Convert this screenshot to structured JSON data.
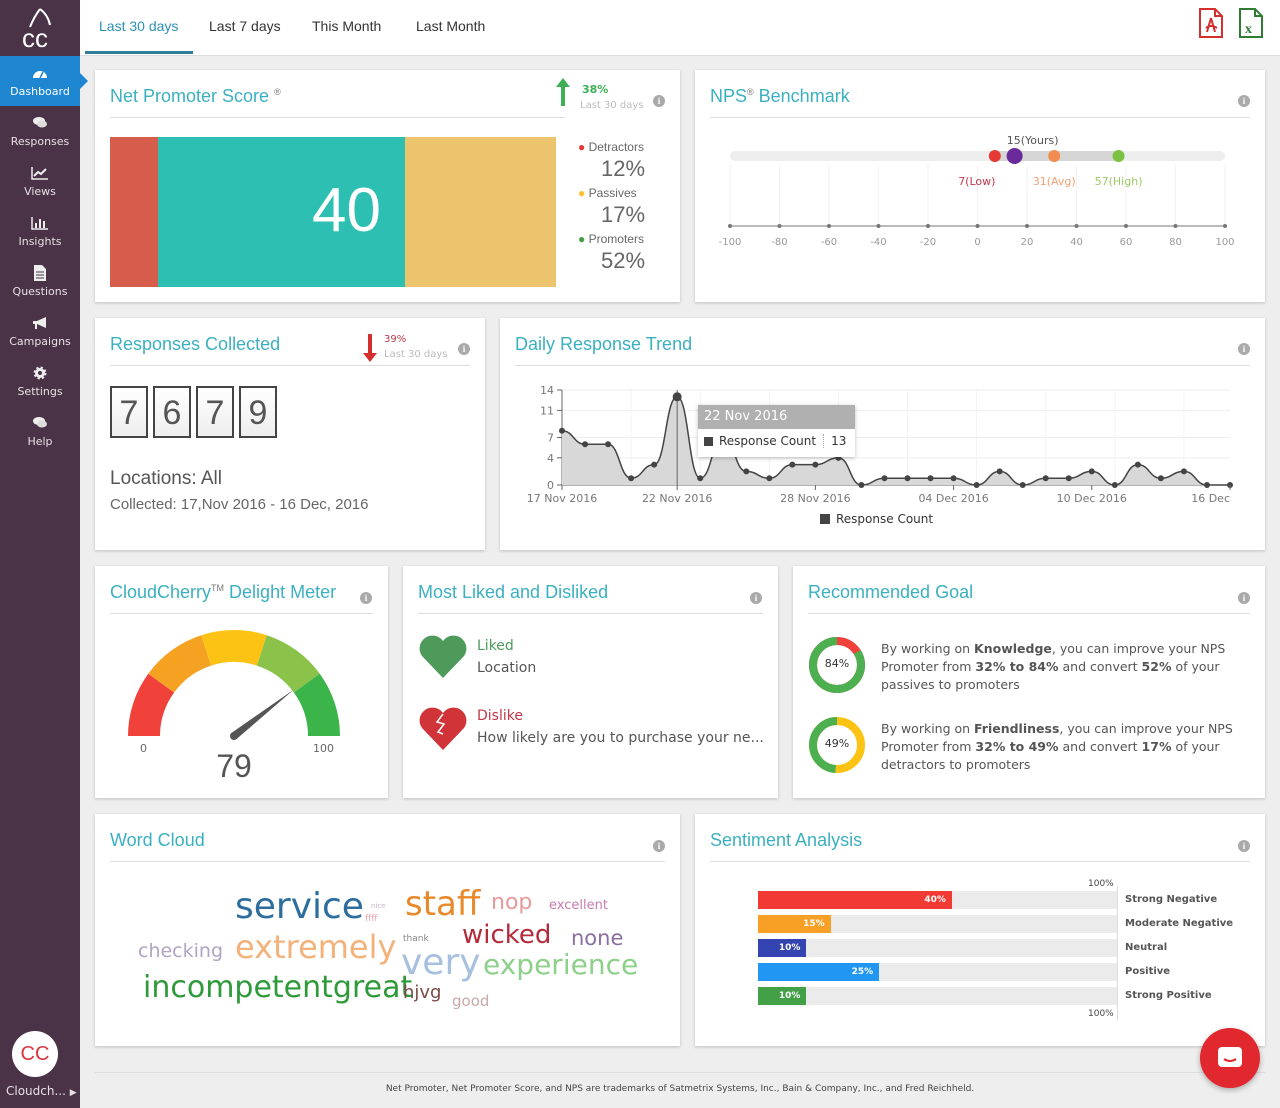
{
  "app": {
    "user_name": "Cloudch...",
    "user_initials": "CC"
  },
  "sidebar": {
    "items": [
      {
        "label": "Dashboard",
        "icon": "dashboard-icon",
        "active": true
      },
      {
        "label": "Responses",
        "icon": "comments-icon"
      },
      {
        "label": "Views",
        "icon": "line-chart-icon"
      },
      {
        "label": "Insights",
        "icon": "bar-chart-icon"
      },
      {
        "label": "Questions",
        "icon": "document-icon"
      },
      {
        "label": "Campaigns",
        "icon": "megaphone-icon"
      },
      {
        "label": "Settings",
        "icon": "gear-icon"
      },
      {
        "label": "Help",
        "icon": "chat-icon"
      }
    ]
  },
  "topbar": {
    "tabs": [
      {
        "label": "Last 30 days",
        "active": true
      },
      {
        "label": "Last 7 days"
      },
      {
        "label": "This Month"
      },
      {
        "label": "Last Month"
      }
    ],
    "export_pdf": "pdf-export-icon",
    "export_excel": "excel-export-icon"
  },
  "nps": {
    "title": "Net Promoter Score",
    "trademark": "®",
    "score": "40",
    "change": "38%",
    "change_period": "Last 30 days",
    "change_direction": "up",
    "detractors_label": "Detractors",
    "detractors_value": "12%",
    "passives_label": "Passives",
    "passives_value": "17%",
    "promoters_label": "Promoters",
    "promoters_value": "52%",
    "colors": {
      "detractors": "#d65c4c",
      "promoters": "#2cbfb2",
      "passives": "#ecc46e"
    }
  },
  "benchmark": {
    "title": "NPS",
    "title_suffix": " Benchmark",
    "trademark": "®",
    "yours_label": "15(Yours)",
    "yours": 15,
    "low_label": "7(Low)",
    "low": 7,
    "avg_label": "31(Avg)",
    "avg": 31,
    "high_label": "57(High)",
    "high": 57,
    "axis_ticks": [
      "-100",
      "-80",
      "-60",
      "-40",
      "-20",
      "0",
      "20",
      "40",
      "60",
      "80",
      "100"
    ]
  },
  "responses": {
    "title": "Responses Collected",
    "change": "39%",
    "change_period": "Last 30 days",
    "change_direction": "down",
    "digits": [
      "7",
      "6",
      "7",
      "9"
    ],
    "locations": "Locations: All",
    "collected": "Collected:  17,Nov 2016 - 16 Dec, 2016"
  },
  "trend": {
    "title": "Daily Response Trend",
    "tooltip_date": "22 Nov 2016",
    "tooltip_series": "Response Count",
    "tooltip_value": "13",
    "legend": "Response Count"
  },
  "chart_data": {
    "type": "area",
    "title": "Daily Response Trend",
    "xlabel": "",
    "ylabel": "",
    "ylim": [
      0,
      14
    ],
    "y_ticks": [
      "0",
      "4",
      "7",
      "11",
      "14"
    ],
    "x_tick_labels": [
      "17 Nov 2016",
      "22 Nov 2016",
      "28 Nov 2016",
      "04 Dec 2016",
      "10 Dec 2016",
      "16 Dec"
    ],
    "x_tick_days": [
      0,
      5,
      11,
      17,
      23,
      29
    ],
    "grid": true,
    "legend": "bottom",
    "series": [
      {
        "name": "Response Count",
        "values": [
          8,
          6,
          6,
          1,
          3,
          13,
          1,
          7,
          2,
          1,
          3,
          3,
          4,
          0,
          1,
          1,
          1,
          1,
          0,
          2,
          0,
          1,
          1,
          2,
          0,
          3,
          1,
          2,
          0,
          0
        ]
      }
    ]
  },
  "delight": {
    "title": "CloudCherry",
    "trademark": "TM",
    "title_suffix": " Delight Meter",
    "value": 79,
    "value_label": "79",
    "min_label": "0",
    "max_label": "100",
    "band_colors": [
      "#f0413a",
      "#f5a223",
      "#fdc314",
      "#8bc34a",
      "#3bb44a"
    ]
  },
  "liked": {
    "title": "Most Liked and Disliked",
    "liked_label": "Liked",
    "liked_value": "Location",
    "dislike_label": "Dislike",
    "dislike_value": "How likely are you to purchase your ne..."
  },
  "goal": {
    "title": "Recommended Goal",
    "items": [
      {
        "percent": 84,
        "percent_label": "84%",
        "p1": "By working on ",
        "b1": "Knowledge",
        "p2": ", you can improve your NPS Promoter from ",
        "b2": "32% to 84%",
        "p3": " and convert ",
        "b3": "52%",
        "p4": " of your passives to promoters",
        "ring_color": "#4caf50",
        "rest_color": "#f0413a"
      },
      {
        "percent": 49,
        "percent_label": "49%",
        "p1": "By working on ",
        "b1": "Friendliness",
        "p2": ", you can improve your NPS Promoter from ",
        "b2": "32% to 49%",
        "p3": " and convert ",
        "b3": "17%",
        "p4": " of your detractors to promoters",
        "ring_color": "#4caf50",
        "rest_color": "#fdc314"
      }
    ]
  },
  "wordcloud": {
    "title": "Word Cloud",
    "words": [
      {
        "text": "service",
        "color": "#2d6e9e"
      },
      {
        "text": "nice",
        "color": "#c9b7c9"
      },
      {
        "text": "ffff",
        "color": "#e6a6b4"
      },
      {
        "text": "staff",
        "color": "#e88a2c"
      },
      {
        "text": "nop",
        "color": "#e69a9c"
      },
      {
        "text": "excellent",
        "color": "#c77ab0"
      },
      {
        "text": "checking",
        "color": "#b0a4c4"
      },
      {
        "text": "extremely",
        "color": "#f2b27a"
      },
      {
        "text": "thank",
        "color": "#888"
      },
      {
        "text": "wicked",
        "color": "#b32a3a"
      },
      {
        "text": "none",
        "color": "#8a6fa0"
      },
      {
        "text": "very",
        "color": "#a7c0e0"
      },
      {
        "text": "experience",
        "color": "#8cd08a"
      },
      {
        "text": "incompetentgreat",
        "color": "#2e9a3a"
      },
      {
        "text": "hjvg",
        "color": "#7a4b44"
      },
      {
        "text": "good",
        "color": "#c9a8a8"
      }
    ]
  },
  "sentiment": {
    "title": "Sentiment Analysis",
    "top_label": "100%",
    "bottom_label": "100%",
    "bars": [
      {
        "label": "Strong Negative",
        "value": 40,
        "value_label": "40%",
        "color": "#f23a34"
      },
      {
        "label": "Moderate Negative",
        "value": 15,
        "value_label": "15%",
        "color": "#f7a025"
      },
      {
        "label": "Neutral",
        "value": 10,
        "value_label": "10%",
        "color": "#3344b0"
      },
      {
        "label": "Positive",
        "value": 25,
        "value_label": "25%",
        "color": "#2196f3"
      },
      {
        "label": "Strong Positive",
        "value": 10,
        "value_label": "10%",
        "color": "#43a047"
      }
    ]
  },
  "footer": {
    "text": "Net Promoter, Net Promoter Score, and NPS are trademarks of Satmetrix Systems, Inc., Bain & Company, Inc., and Fred Reichheld."
  },
  "chat": {
    "icon": "chat-bubble-icon"
  }
}
